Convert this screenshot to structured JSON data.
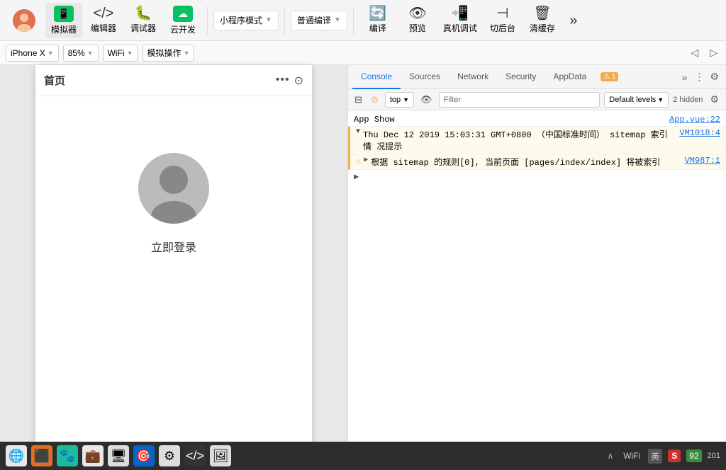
{
  "toolbar": {
    "items": [
      {
        "id": "simulate",
        "label": "模拟器",
        "icon": "👤"
      },
      {
        "id": "editor",
        "label": "编辑器",
        "icon": "</>"
      },
      {
        "id": "debug",
        "label": "调试器",
        "icon": "🔧"
      },
      {
        "id": "cloud",
        "label": "云开发",
        "icon": "☁️"
      }
    ],
    "mode_label": "小程序模式",
    "compile_label": "普通编译",
    "compile_btn": "编译",
    "preview_btn": "预览",
    "real_debug_btn": "真机调试",
    "cut_backend_btn": "切后台",
    "clear_cache_btn": "清缓存"
  },
  "device_bar": {
    "device": "iPhone X",
    "zoom": "85%",
    "network": "WiFi",
    "operation": "模拟操作"
  },
  "phone": {
    "title": "首页",
    "login_text": "立即登录"
  },
  "devtools": {
    "tabs": [
      "Console",
      "Sources",
      "Network",
      "Security",
      "AppData"
    ],
    "more_label": "»",
    "console": {
      "context": "top",
      "filter_placeholder": "Filter",
      "level": "Default levels",
      "hidden": "2 hidden",
      "rows": [
        {
          "type": "info",
          "content": "App Show",
          "source": "App.vue:22",
          "expanded": false
        },
        {
          "type": "collapsed",
          "content": "Thu Dec 12 2019 15:03:31 GMT+0800 （中国标准时间） sitemap 索引情 况提示",
          "source": "VM1018:4",
          "expanded": true
        },
        {
          "type": "warn",
          "content": "根据 sitemap 的规则[0], 当前页面 [pages/index/index] 将被索引",
          "source": "VM987:1",
          "hasArrow": true
        }
      ]
    }
  },
  "taskbar": {
    "icons": [
      "🌐",
      "🟧",
      "🐾",
      "💼",
      "🖥️",
      "🎯",
      "⚙️",
      "</>",
      "🖼️"
    ],
    "sys_area": {
      "arrow_label": "∧",
      "wifi_icon": "WiFi",
      "lang": "英",
      "sougou": "S",
      "battery": "92",
      "time": "201"
    }
  },
  "warn_badge": "⚠ 1"
}
